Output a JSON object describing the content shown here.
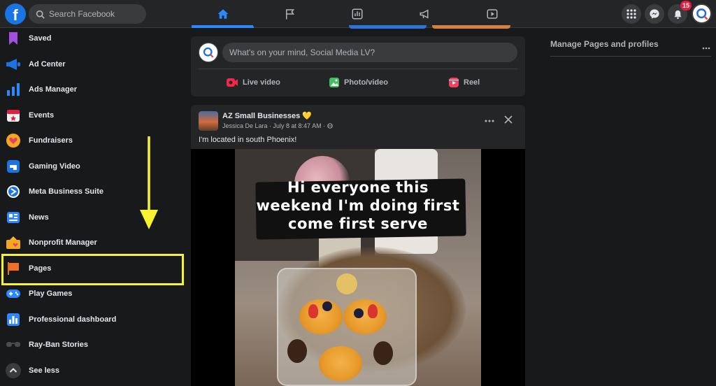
{
  "topbar": {
    "search_placeholder": "Search Facebook",
    "notification_count": "15"
  },
  "sidebar": {
    "items": [
      {
        "label": "Saved"
      },
      {
        "label": "Ad Center"
      },
      {
        "label": "Ads Manager"
      },
      {
        "label": "Events"
      },
      {
        "label": "Fundraisers"
      },
      {
        "label": "Gaming Video"
      },
      {
        "label": "Meta Business Suite"
      },
      {
        "label": "News"
      },
      {
        "label": "Nonprofit Manager"
      },
      {
        "label": "Pages"
      },
      {
        "label": "Play Games"
      },
      {
        "label": "Professional dashboard"
      },
      {
        "label": "Ray-Ban Stories"
      },
      {
        "label": "See less"
      }
    ],
    "highlighted_item": "Pages"
  },
  "composer": {
    "placeholder": "What's on your mind, Social Media LV?",
    "actions": [
      {
        "label": "Live video"
      },
      {
        "label": "Photo/video"
      },
      {
        "label": "Reel"
      }
    ]
  },
  "post": {
    "group_name": "AZ Small Businesses 💛",
    "author_meta": "Jessica De Lara · July 8 at 8:47 AM · ",
    "text": "I'm located in south Phoenix!",
    "image_caption_lines": [
      "Hi everyone this",
      "weekend I'm doing first",
      "come first serve"
    ]
  },
  "right_panel": {
    "title": "Manage Pages and profiles"
  },
  "colors": {
    "accent": "#2d88ff",
    "highlight": "#f7f32f",
    "background": "#18191a",
    "surface": "#242526"
  }
}
